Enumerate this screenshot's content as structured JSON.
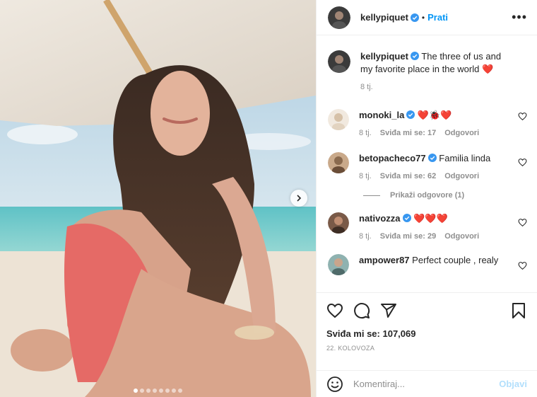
{
  "header": {
    "username": "kellypiquet",
    "separator": "•",
    "follow_label": "Prati",
    "more_label": "•••"
  },
  "caption": {
    "username": "kellypiquet",
    "text": "The three of us and my favorite place in the world",
    "emoji": "❤️",
    "time": "8 tj."
  },
  "comments": [
    {
      "username": "monoki_la",
      "text": "❤️🐞❤️",
      "time": "8 tj.",
      "likes": "Sviđa mi se: 17",
      "reply": "Odgovori"
    },
    {
      "username": "betopacheco77",
      "text": "Familia linda",
      "time": "8 tj.",
      "likes": "Sviđa mi se: 62",
      "reply": "Odgovori"
    },
    {
      "username": "nativozza",
      "text": "❤️❤️❤️",
      "time": "8 tj.",
      "likes": "Sviđa mi se: 29",
      "reply": "Odgovori"
    },
    {
      "username": "ampower87",
      "text": "Perfect couple , realy"
    }
  ],
  "show_replies": "Prikaži odgovore (1)",
  "actions": {
    "likes": "Sviđa mi se: 107,069",
    "date": "22. KOLOVOZA"
  },
  "composer": {
    "placeholder": "Komentiraj...",
    "post_label": "Objavi"
  },
  "carousel": {
    "dot_count": 8,
    "active_index": 0
  },
  "colors": {
    "accent": "#0095f6",
    "verified": "#3897f0",
    "heart": "#ed4956",
    "muted": "#8e8e8e"
  },
  "icons": [
    "more-icon",
    "verified-icon",
    "heart-icon",
    "comment-icon",
    "share-icon",
    "bookmark-icon",
    "emoji-icon",
    "chevron-right-icon"
  ]
}
